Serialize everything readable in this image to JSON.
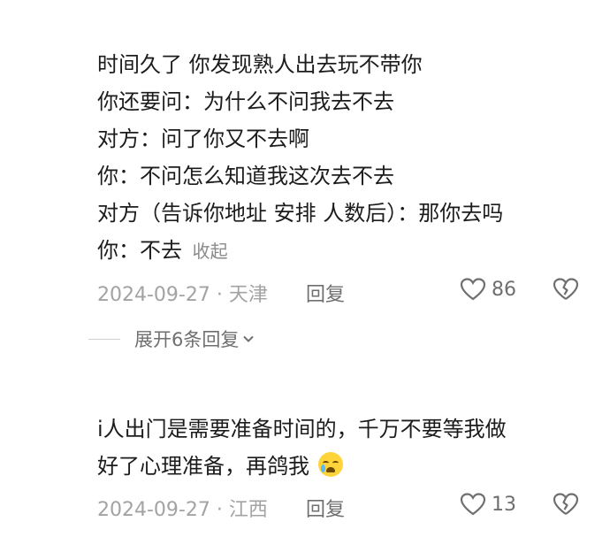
{
  "comment1": {
    "lines": [
      "时间久了 你发现熟人出去玩不带你",
      "你还要问：为什么不问我去不去",
      "对方：问了你又不去啊",
      "你：不问怎么知道我这次去不去",
      "对方（告诉你地址 安排 人数后）：那你去吗",
      "你：不去"
    ],
    "collapse_label": "收起",
    "meta": {
      "date_location": "2024-09-27 · 天津",
      "reply_label": "回复",
      "like_count": "86"
    }
  },
  "replies": {
    "expand_label": "展开6条回复"
  },
  "comment2": {
    "lines": [
      "i人出门是需要准备时间的，千万不要等我做",
      "好了心理准备，再鸽我"
    ],
    "emoji": "crying-face-emoji",
    "meta": {
      "date_location": "2024-09-27 · 江西",
      "reply_label": "回复",
      "like_count": "13"
    }
  }
}
